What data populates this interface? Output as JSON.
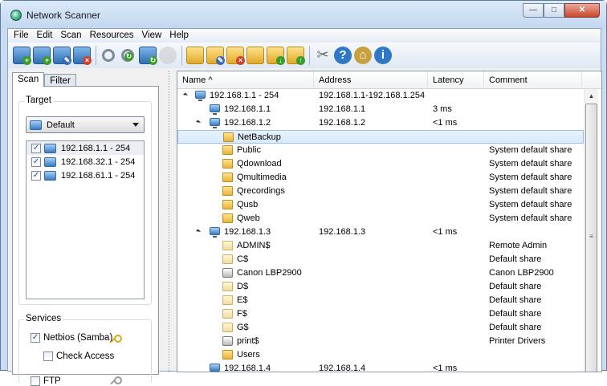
{
  "window": {
    "title": "Network Scanner",
    "min": "—",
    "max": "□",
    "close": "✕"
  },
  "menu": [
    "File",
    "Edit",
    "Scan",
    "Resources",
    "View",
    "Help"
  ],
  "toolbar": [
    {
      "name": "add-computer-icon",
      "kind": "comp",
      "badge": "+",
      "bc": "g"
    },
    {
      "name": "add-range-icon",
      "kind": "comp",
      "badge": "+",
      "bc": "g"
    },
    {
      "name": "edit-computer-icon",
      "kind": "comp",
      "badge": "✎",
      "bc": "b"
    },
    {
      "name": "delete-computer-icon",
      "kind": "comp",
      "badge": "×",
      "bc": "r"
    },
    {
      "sep": true
    },
    {
      "name": "find-icon",
      "kind": "mag"
    },
    {
      "name": "find-refresh-icon",
      "kind": "mag",
      "badge": "↻",
      "bc": "g"
    },
    {
      "name": "rescan-icon",
      "kind": "comp",
      "badge": "↻",
      "bc": "g"
    },
    {
      "name": "disabled-scan-icon",
      "kind": "dis"
    },
    {
      "sep": true
    },
    {
      "name": "open-folder-icon",
      "kind": "fold"
    },
    {
      "name": "edit-folder-icon",
      "kind": "fold",
      "badge": "✎",
      "bc": "b"
    },
    {
      "name": "delete-folder-icon",
      "kind": "fold",
      "badge": "×",
      "bc": "r"
    },
    {
      "name": "binoculars-icon",
      "kind": "fold"
    },
    {
      "name": "import-icon",
      "kind": "fold",
      "badge": "↓",
      "bc": "g"
    },
    {
      "name": "export-icon",
      "kind": "fold",
      "badge": "↑",
      "bc": "g"
    },
    {
      "sep": true
    },
    {
      "name": "tools-icon",
      "kind": "tools"
    },
    {
      "name": "help-icon",
      "kind": "round",
      "glyph": "?",
      "color": "#2f78c8"
    },
    {
      "name": "home-icon",
      "kind": "round",
      "glyph": "⌂",
      "color": "#c9a040"
    },
    {
      "name": "info-icon",
      "kind": "round",
      "glyph": "i",
      "color": "#2f78c8"
    }
  ],
  "left": {
    "tabs": [
      "Scan",
      "Filter"
    ],
    "target_label": "Target",
    "combo_value": "Default",
    "targets": [
      "192.168.1.1 - 254",
      "192.168.32.1 - 254",
      "192.168.61.1 - 254"
    ],
    "services_label": "Services",
    "netbios": "Netbios (Samba)",
    "check_access": "Check Access",
    "ftp": "FTP"
  },
  "table": {
    "columns": [
      "Name ^",
      "Address",
      "Latency",
      "Comment"
    ],
    "rows": [
      {
        "level": 0,
        "exp": true,
        "icon": "comp",
        "name": "192.168.1.1 - 254",
        "address": "192.168.1.1-192.168.1.254",
        "latency": "",
        "comment": ""
      },
      {
        "level": 1,
        "exp": false,
        "icon": "comp",
        "name": "192.168.1.1",
        "address": "192.168.1.1",
        "latency": "3 ms",
        "comment": ""
      },
      {
        "level": 1,
        "exp": true,
        "icon": "comp",
        "name": "192.168.1.2",
        "address": "192.168.1.2",
        "latency": "<1 ms",
        "comment": ""
      },
      {
        "level": 2,
        "icon": "fopen",
        "name": "NetBackup",
        "address": "",
        "latency": "",
        "comment": "",
        "selected": true
      },
      {
        "level": 2,
        "icon": "fopen",
        "name": "Public",
        "address": "",
        "latency": "",
        "comment": "System default share"
      },
      {
        "level": 2,
        "icon": "fopen",
        "name": "Qdownload",
        "address": "",
        "latency": "",
        "comment": "System default share"
      },
      {
        "level": 2,
        "icon": "fopen",
        "name": "Qmultimedia",
        "address": "",
        "latency": "",
        "comment": "System default share"
      },
      {
        "level": 2,
        "icon": "fopen",
        "name": "Qrecordings",
        "address": "",
        "latency": "",
        "comment": "System default share"
      },
      {
        "level": 2,
        "icon": "fopen",
        "name": "Qusb",
        "address": "",
        "latency": "",
        "comment": "System default share"
      },
      {
        "level": 2,
        "icon": "fopen",
        "name": "Qweb",
        "address": "",
        "latency": "",
        "comment": "System default share"
      },
      {
        "level": 1,
        "exp": true,
        "icon": "comp",
        "name": "192.168.1.3",
        "address": "192.168.1.3",
        "latency": "<1 ms",
        "comment": ""
      },
      {
        "level": 2,
        "icon": "fclosed",
        "name": "ADMIN$",
        "address": "",
        "latency": "",
        "comment": "Remote Admin"
      },
      {
        "level": 2,
        "icon": "fclosed",
        "name": "C$",
        "address": "",
        "latency": "",
        "comment": "Default share"
      },
      {
        "level": 2,
        "icon": "print",
        "name": "Canon LBP2900",
        "address": "",
        "latency": "",
        "comment": "Canon LBP2900"
      },
      {
        "level": 2,
        "icon": "fclosed",
        "name": "D$",
        "address": "",
        "latency": "",
        "comment": "Default share"
      },
      {
        "level": 2,
        "icon": "fclosed",
        "name": "E$",
        "address": "",
        "latency": "",
        "comment": "Default share"
      },
      {
        "level": 2,
        "icon": "fclosed",
        "name": "F$",
        "address": "",
        "latency": "",
        "comment": "Default share"
      },
      {
        "level": 2,
        "icon": "fclosed",
        "name": "G$",
        "address": "",
        "latency": "",
        "comment": "Default share"
      },
      {
        "level": 2,
        "icon": "print",
        "name": "print$",
        "address": "",
        "latency": "",
        "comment": "Printer Drivers"
      },
      {
        "level": 2,
        "icon": "fopen",
        "name": "Users",
        "address": "",
        "latency": "",
        "comment": ""
      },
      {
        "level": 1,
        "exp": false,
        "icon": "comp",
        "name": "192.168.1.4",
        "address": "192.168.1.4",
        "latency": "<1 ms",
        "comment": ""
      }
    ]
  }
}
